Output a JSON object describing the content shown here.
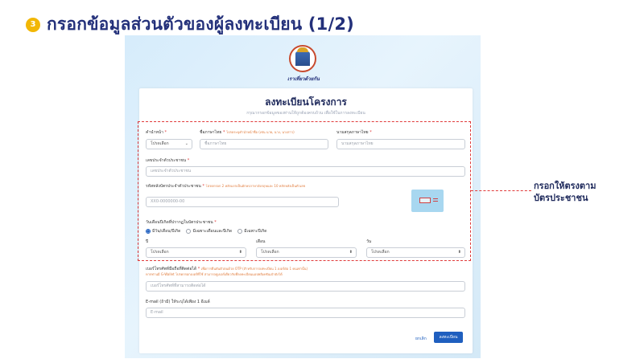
{
  "header": {
    "step_number": "3",
    "title": "กรอกข้อมูลส่วนตัวของผู้ลงทะเบียน (1/2)"
  },
  "brand": {
    "logo_text": "เราเที่ยวด้วยกัน"
  },
  "form": {
    "title": "ลงทะเบียนโครงการ",
    "subtitle": "กรุณากรอกข้อมูลของท่านให้ถูกต้องครบถ้วน เพื่อใช้ในการลงทะเบียน",
    "prefix": {
      "label": "คำนำหน้า",
      "req": "*",
      "value": "โปรดเลือก"
    },
    "first_name": {
      "label": "ชื่อภาษาไทย",
      "req": "*",
      "hint": "โปรดระบุคำนำหน้าชื่อ (เช่น นาย, นาง, นางสาว)",
      "placeholder": "ชื่อภาษาไทย"
    },
    "last_name": {
      "label": "นามสกุลภาษาไทย",
      "req": "*",
      "placeholder": "นามสกุลภาษาไทย"
    },
    "citizen_id": {
      "label": "เลขประจำตัวประชาชน",
      "req": "*",
      "placeholder": "เลขประจำตัวประชาชน"
    },
    "laser_id": {
      "label": "รหัสหลังบัตรประจำตัวประชาชน",
      "req": "*",
      "hint": "โปรดกรอก 2 หลักแรกเป็นอักษรภาษาอังกฤษและ 10 หลักหลังเป็นตัวเลข",
      "placeholder": "XX0-0000000-00"
    },
    "birth": {
      "label": "วันเดือนปีเกิดที่ปรากฏในบัตรประชาชน",
      "req": "*",
      "options": [
        "มีวัน/เดือน/ปีเกิด",
        "มีเฉพาะเดือนและปีเกิด",
        "มีเฉพาะปีเกิด"
      ],
      "year_label": "ปี",
      "month_label": "เดือน",
      "day_label": "วัน",
      "select_placeholder": "โปรดเลือก"
    },
    "phone": {
      "label": "เบอร์โทรศัพท์มือถือที่ติดต่อได้",
      "req": "*",
      "hint": "เพื่อการยืนยันตัวตนด้วย OTP (สำหรับการลงทะเบียน 1 เบอร์ต่อ 1 คนเท่านั้น)",
      "hint2": "หากท่านมี G-Wallet โปรดกรอกเบอร์ที่ใช้ สามารถดูเบอร์เดียวกับที่ลงทะเบียนแอปพลิเคชันเป๋าตังได้",
      "placeholder": "เบอร์โทรศัพท์ที่สามารถติดต่อได้"
    },
    "email": {
      "label": "E-mail (ถ้ามี) ให้ระบุได้เพียง 1 อีเมล์",
      "placeholder": "E-mail"
    },
    "cancel_label": "ยกเลิก",
    "submit_label": "ลงทะเบียน"
  },
  "callout": {
    "line1": "กรอกให้ตรงตาม",
    "line2": "บัตรประชาชน"
  }
}
